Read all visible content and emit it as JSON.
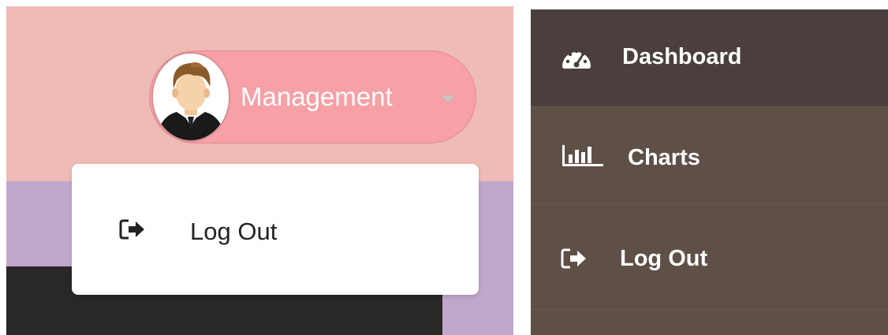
{
  "header": {
    "user_name": "Management",
    "avatar_icon": "user-avatar",
    "caret_icon": "caret-down-icon"
  },
  "dropdown": {
    "items": [
      {
        "label": "Log Out",
        "icon": "sign-out-icon"
      }
    ]
  },
  "sidebar": {
    "items": [
      {
        "label": "Dashboard",
        "icon": "tachometer-icon",
        "active": true
      },
      {
        "label": "Charts",
        "icon": "bar-chart-icon"
      },
      {
        "label": "Log Out",
        "icon": "sign-out-icon"
      }
    ]
  },
  "colors": {
    "header_bg": "#efbbb5",
    "pill_bg": "#f7a0a6",
    "content_bg": "#c2a7cd",
    "sidebar_bg": "#5e4f47",
    "sidebar_active_bg": "#4a3f3c",
    "text_light": "#ffffff",
    "text_dark": "#222222"
  }
}
